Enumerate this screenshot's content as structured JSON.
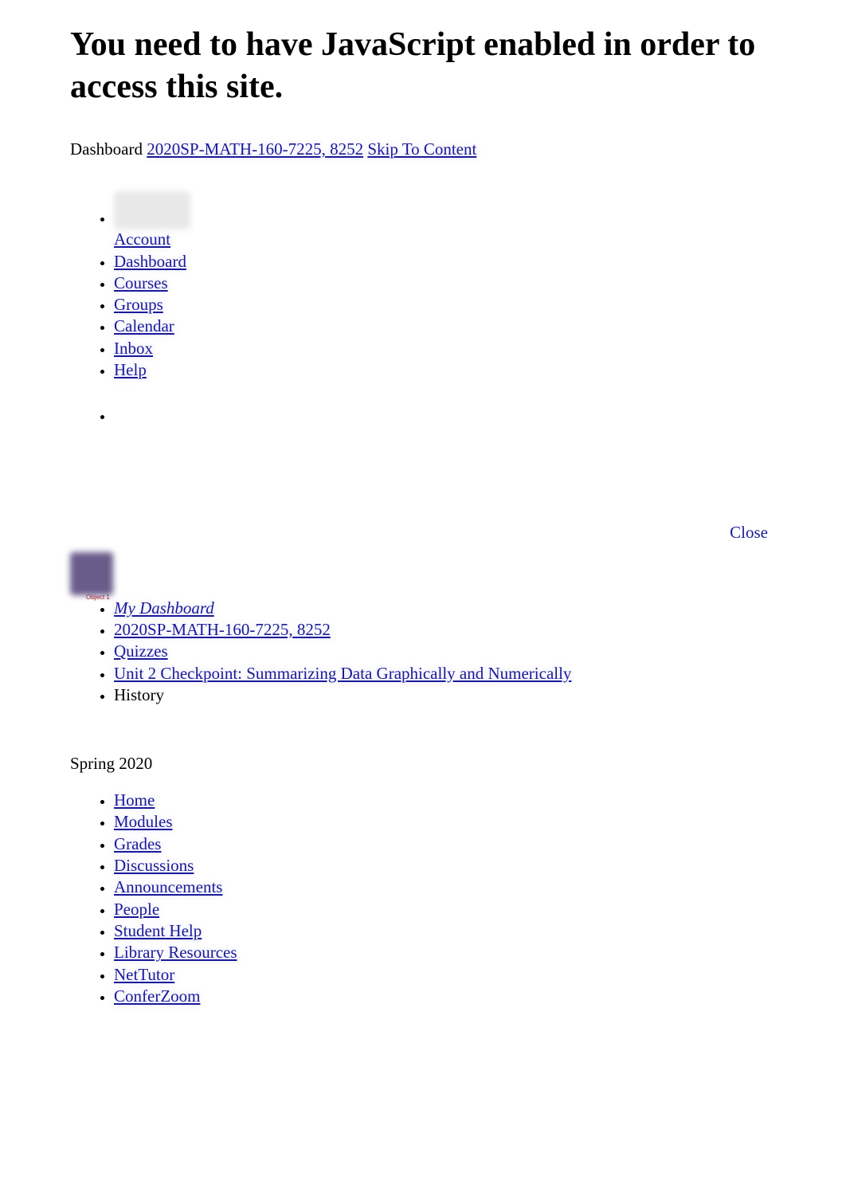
{
  "heading": "You need to have JavaScript enabled in order to access this site.",
  "top_breadcrumb": {
    "dashboard": "Dashboard",
    "course": "2020SP-MATH-160-7225, 8252",
    "skip": "Skip To Content"
  },
  "global_nav": {
    "account": "Account",
    "dashboard": "Dashboard",
    "courses": "Courses",
    "groups": "Groups",
    "calendar": "Calendar",
    "inbox": "Inbox",
    "help": "Help"
  },
  "close_label": "Close",
  "object_label": "Object 1",
  "breadcrumbs": {
    "my_dashboard": "My Dashboard",
    "course": "2020SP-MATH-160-7225, 8252",
    "quizzes": "Quizzes",
    "quiz_title": "Unit 2 Checkpoint: Summarizing Data Graphically and Numerically",
    "history": "History"
  },
  "term": "Spring 2020",
  "course_nav": {
    "home": "Home",
    "modules": "Modules",
    "grades": "Grades",
    "discussions": "Discussions",
    "announcements": "Announcements",
    "people": "People",
    "student_help": "Student Help",
    "library_resources": "Library Resources",
    "nettutor": "NetTutor",
    "conferzoom": "ConferZoom"
  }
}
